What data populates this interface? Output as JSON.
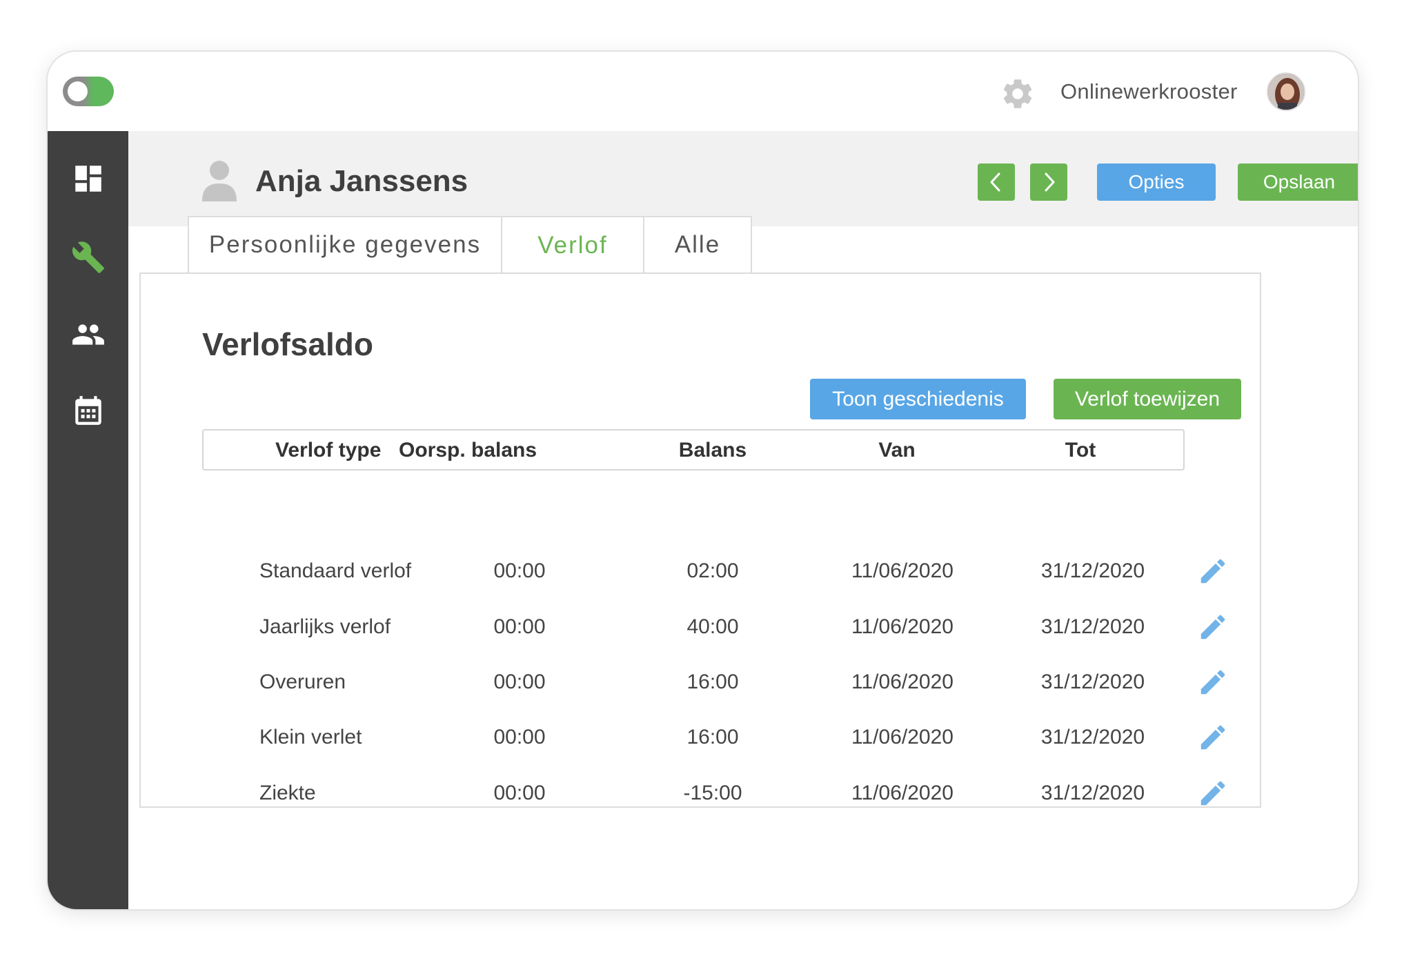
{
  "app": {
    "brand": "Onlinewerkrooster"
  },
  "employee": {
    "name": "Anja Janssens"
  },
  "header": {
    "options_label": "Opties",
    "save_label": "Opslaan"
  },
  "tabs": [
    {
      "label": "Persoonlijke gegevens"
    },
    {
      "label": "Verlof"
    },
    {
      "label": "Alle"
    }
  ],
  "section": {
    "title": "Verlofsaldo",
    "history_label": "Toon geschiedenis",
    "assign_label": "Verlof toewijzen"
  },
  "table": {
    "headers": [
      "Verlof type",
      "Oorsp. balans",
      "Balans",
      "Van",
      "Tot"
    ],
    "rows": [
      {
        "type": "Standaard verlof",
        "orig": "00:00",
        "balance": "02:00",
        "from": "11/06/2020",
        "to": "31/12/2020"
      },
      {
        "type": "Jaarlijks verlof",
        "orig": "00:00",
        "balance": "40:00",
        "from": "11/06/2020",
        "to": "31/12/2020"
      },
      {
        "type": "Overuren",
        "orig": "00:00",
        "balance": "16:00",
        "from": "11/06/2020",
        "to": "31/12/2020"
      },
      {
        "type": "Klein verlet",
        "orig": "00:00",
        "balance": "16:00",
        "from": "11/06/2020",
        "to": "31/12/2020"
      },
      {
        "type": "Ziekte",
        "orig": "00:00",
        "balance": "-15:00",
        "from": "11/06/2020",
        "to": "31/12/2020"
      }
    ]
  },
  "colors": {
    "accent_green": "#6ab552",
    "accent_blue": "#58a6e6",
    "sidebar": "#404040",
    "edit_icon": "#72b3e8"
  },
  "icons": {
    "sidebar": [
      "dashboard-icon",
      "wrench-icon",
      "users-icon",
      "calendar-icon"
    ],
    "topbar": [
      "toggle-switch",
      "gear-icon",
      "avatar"
    ],
    "row_action": "pencil-icon"
  }
}
